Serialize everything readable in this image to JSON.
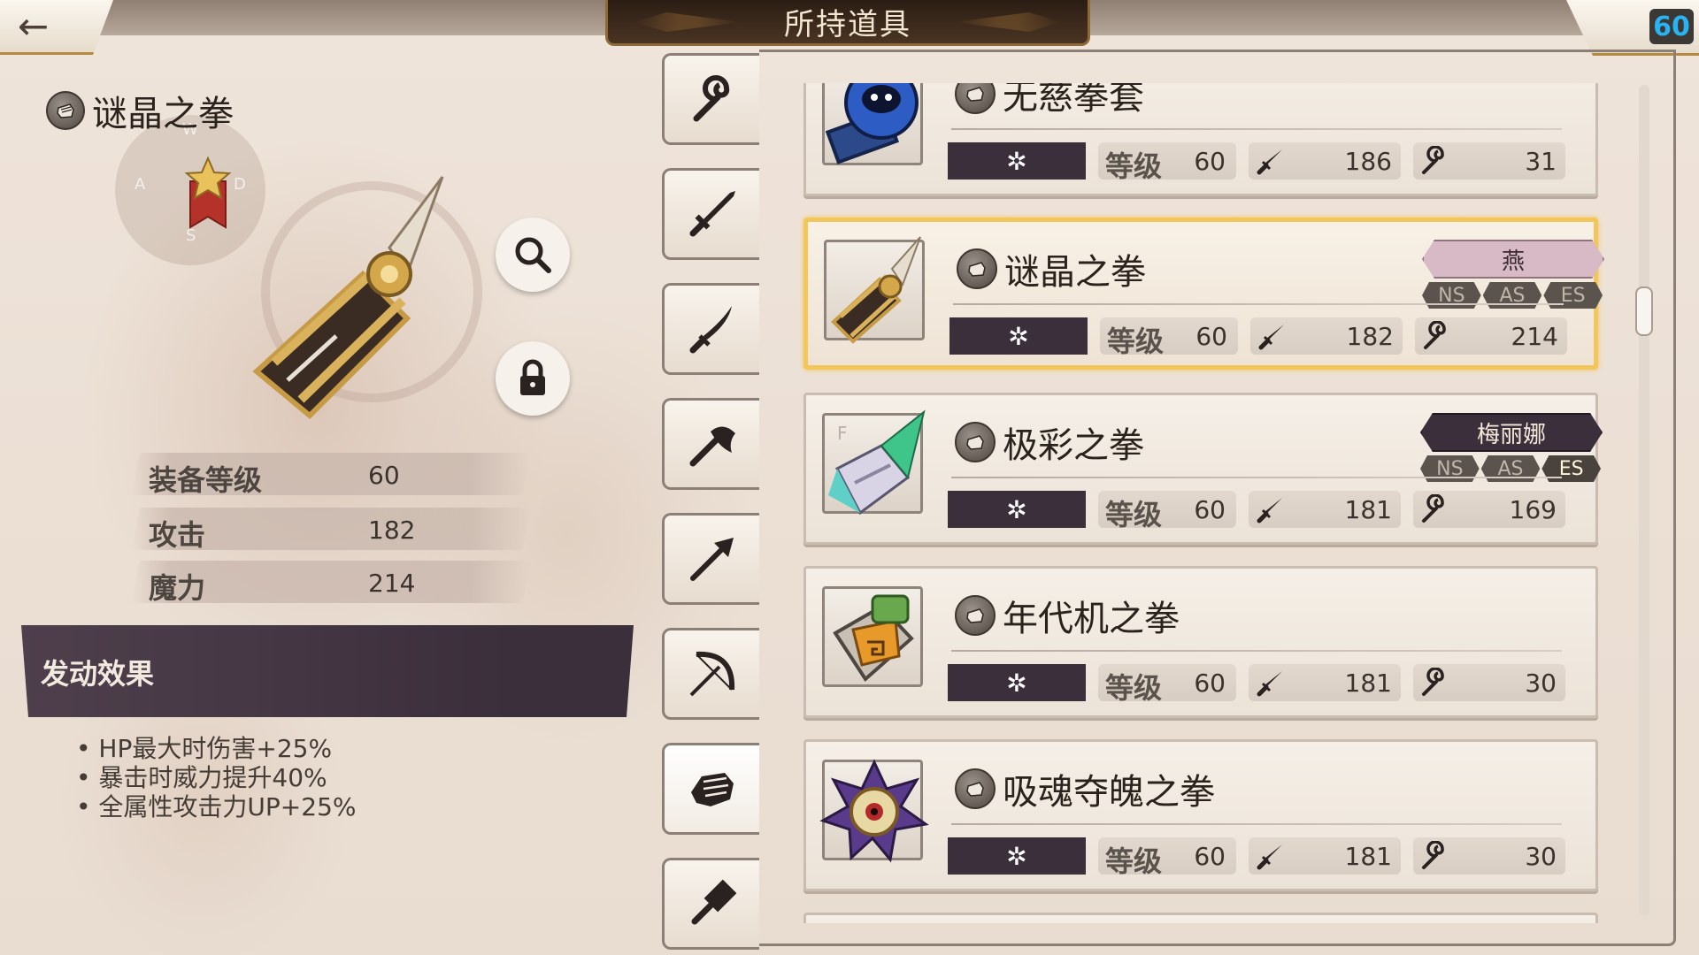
{
  "header": {
    "title": "所持道具",
    "back_label": "←",
    "player_level": "60"
  },
  "detail": {
    "name": "谜晶之拳",
    "stats": [
      {
        "label": "装备等级",
        "value": "60"
      },
      {
        "label": "攻击",
        "value": "182"
      },
      {
        "label": "魔力",
        "value": "214"
      }
    ],
    "effect_title": "发动效果",
    "effects": [
      "HP最大时伤害+25%",
      "暴击时威力提升40%",
      "全属性攻击力UP+25%"
    ],
    "compass": {
      "n": "W",
      "w": "A",
      "e": "D",
      "s": "S"
    }
  },
  "tabs": [
    {
      "icon": "staff-icon"
    },
    {
      "icon": "sword-icon"
    },
    {
      "icon": "katana-icon"
    },
    {
      "icon": "axe-icon"
    },
    {
      "icon": "spear-icon"
    },
    {
      "icon": "bow-icon"
    },
    {
      "icon": "fist-icon",
      "active": true
    },
    {
      "icon": "hammer-icon"
    }
  ],
  "items": [
    {
      "name": "无慈拳套",
      "level_label": "等级",
      "level": "60",
      "attack": "186",
      "magic": "31",
      "element": "✲",
      "owner": null
    },
    {
      "name": "谜晶之拳",
      "level_label": "等级",
      "level": "60",
      "attack": "182",
      "magic": "214",
      "element": "✲",
      "owner": "燕",
      "owner_color": "#d8b9c6",
      "owner_text_color": "#3a2a30",
      "classes": [
        "NS",
        "AS",
        "ES"
      ],
      "class_on": [],
      "selected": true
    },
    {
      "name": "极彩之拳",
      "level_label": "等级",
      "level": "60",
      "attack": "181",
      "magic": "169",
      "element": "✲",
      "owner": "梅丽娜",
      "owner_color": "#3b2f3b",
      "owner_text_color": "#f5ead9",
      "classes": [
        "NS",
        "AS",
        "ES"
      ],
      "class_on": [
        "ES"
      ],
      "thumb_letter": "F"
    },
    {
      "name": "年代机之拳",
      "level_label": "等级",
      "level": "60",
      "attack": "181",
      "magic": "30",
      "element": "✲",
      "owner": null
    },
    {
      "name": "吸魂夺魄之拳",
      "level_label": "等级",
      "level": "60",
      "attack": "181",
      "magic": "30",
      "element": "✲",
      "owner": null
    }
  ],
  "colors": {
    "accent_gold": "#f2c65a",
    "element_bar": "#3b2f3b",
    "level_blue": "#29b3f0"
  }
}
